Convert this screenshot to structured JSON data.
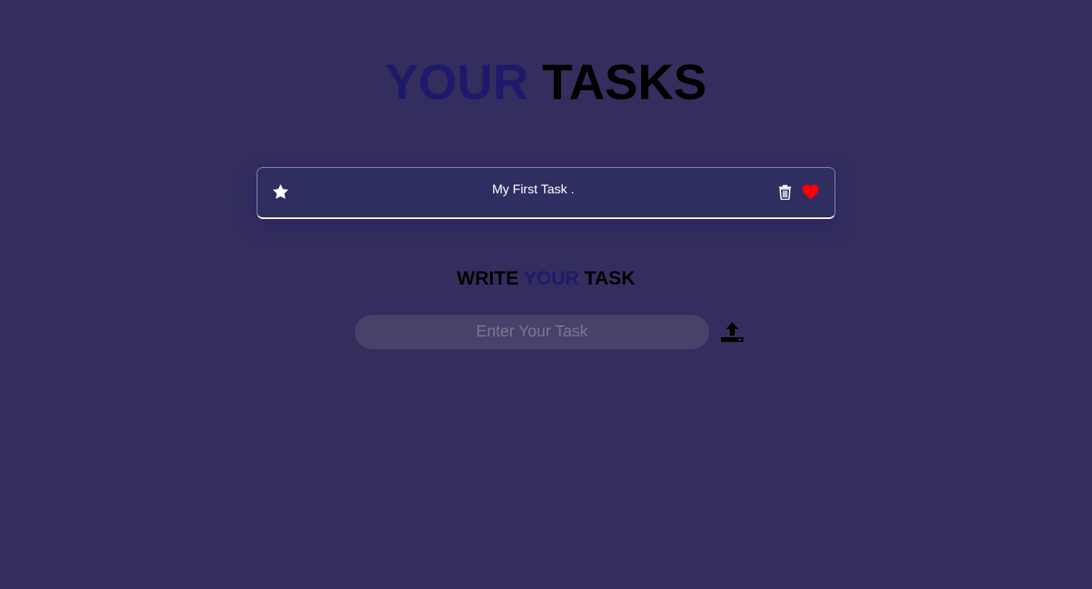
{
  "title": {
    "part1": "YOUR",
    "part2": "TASKS"
  },
  "tasks": [
    {
      "text": "My First Task .",
      "star_icon": "star-icon",
      "delete_icon": "trash-icon",
      "favorite_icon": "heart-icon"
    }
  ],
  "form": {
    "heading_part1": "WRITE",
    "heading_part2": "YOUR",
    "heading_part3": "TASK",
    "input_placeholder": "Enter Your Task",
    "input_value": "",
    "submit_icon": "upload-icon"
  },
  "colors": {
    "background": "#332e5d",
    "accent": "#1e1a6b",
    "heart": "#ff0000",
    "text_light": "#ffffff",
    "text_dark": "#000000"
  }
}
